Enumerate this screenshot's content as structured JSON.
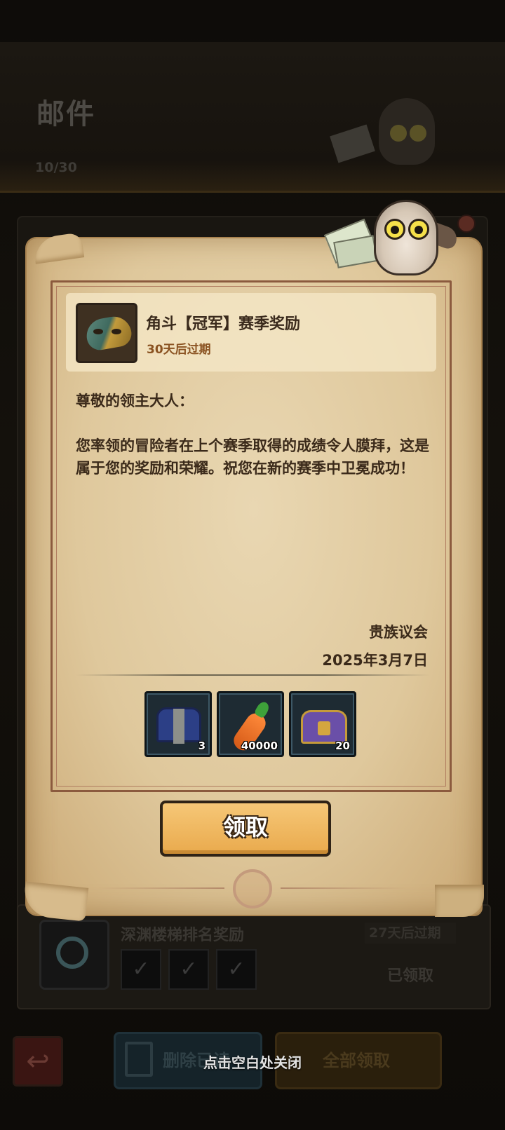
{
  "background": {
    "title": "邮件",
    "count": "10/30",
    "list_item": {
      "title": "深渊楼梯排名奖励",
      "expire": "27天后过期",
      "status": "已领取"
    },
    "buttons": {
      "delete_read": "删除已读",
      "claim_all": "全部领取"
    }
  },
  "close_hint": "点击空白处关闭",
  "mail": {
    "title": "角斗【冠军】赛季奖励",
    "expire": "30天后过期",
    "greeting": "尊敬的领主大人：",
    "body": "您率领的冒险者在上个赛季取得的成绩令人膜拜，这是属于您的奖励和荣耀。祝您在新的赛季中卫冕成功！",
    "signer": "贵族议会",
    "date": "2025年3月7日",
    "rewards": [
      {
        "icon": "blue-chest-icon",
        "qty": "3"
      },
      {
        "icon": "carrot-icon",
        "qty": "40000"
      },
      {
        "icon": "golden-chest-icon",
        "qty": "20"
      }
    ],
    "claim_label": "领取"
  },
  "colors": {
    "parchment": "#dfc89c",
    "button_gold": "#e9aa4d",
    "frame_brown": "#8b5a3e",
    "expire_text": "#8a5221"
  }
}
